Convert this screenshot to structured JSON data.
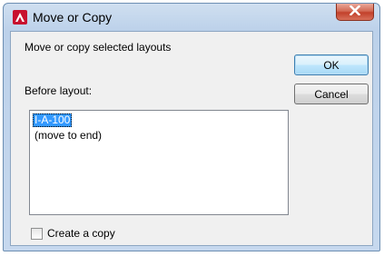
{
  "window": {
    "title": "Move or Copy",
    "icon": "autocad-logo-icon",
    "close_icon": "close-icon",
    "accent": "#c0392b"
  },
  "dialog": {
    "prompt": "Move or copy selected layouts",
    "before_label": "Before layout:",
    "layouts": [
      "I-A-100",
      "(move to end)"
    ],
    "selected_layout": "I-A-100",
    "create_copy_label": "Create a copy",
    "create_copy_checked": false
  },
  "buttons": {
    "ok": "OK",
    "cancel": "Cancel"
  }
}
